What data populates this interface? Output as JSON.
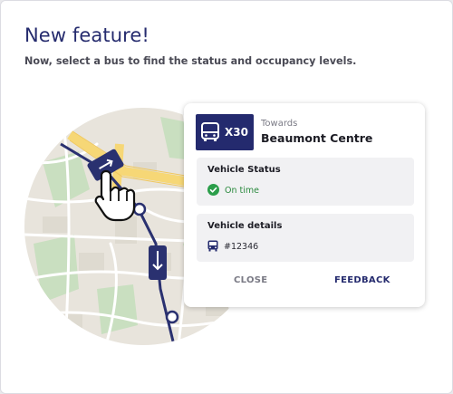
{
  "dialog": {
    "title": "New feature!",
    "subtitle": "Now, select a bus to find the status and occupancy levels."
  },
  "card": {
    "route_number": "X30",
    "towards_label": "Towards",
    "destination": "Beaumont Centre",
    "status_panel": {
      "title": "Vehicle Status",
      "status_text": "On time",
      "status_icon": "check-circle-icon"
    },
    "details_panel": {
      "title": "Vehicle details",
      "vehicle_id": "#12346",
      "vehicle_icon": "bus-icon"
    },
    "close_label": "CLOSE",
    "feedback_label": "FEEDBACK"
  },
  "colors": {
    "brand_navy": "#242a6e",
    "on_time_green": "#2b9e4a",
    "map_background": "#e8e4dc",
    "map_park": "#c9dfc0",
    "map_major_road": "#f6d776"
  }
}
